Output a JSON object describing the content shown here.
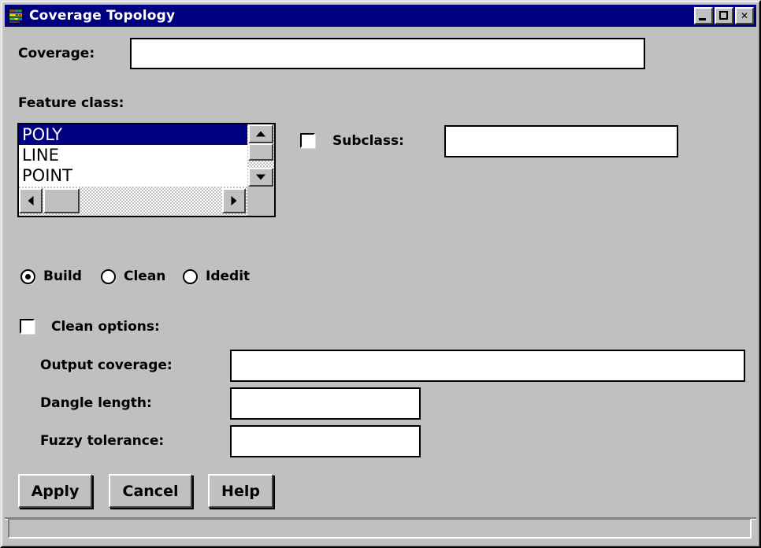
{
  "window": {
    "title": "Coverage Topology",
    "icon": "coverage-layers-icon",
    "titlebar_color": "#000080",
    "face_color": "#c0c0c0",
    "controls": {
      "minimize": "_",
      "maximize": "□",
      "close": "✕"
    }
  },
  "coverage": {
    "label": "Coverage:",
    "value": "",
    "placeholder": ""
  },
  "feature_class": {
    "label": "Feature class:",
    "items": [
      {
        "label": "POLY",
        "selected": true
      },
      {
        "label": "LINE",
        "selected": false
      },
      {
        "label": "POINT",
        "selected": false
      }
    ]
  },
  "subclass": {
    "label": "Subclass:",
    "checked": false,
    "value": "",
    "placeholder": ""
  },
  "operation": {
    "options": [
      {
        "label": "Build",
        "selected": true
      },
      {
        "label": "Clean",
        "selected": false
      },
      {
        "label": "Idedit",
        "selected": false
      }
    ]
  },
  "clean_options": {
    "label": "Clean options:",
    "checked": false,
    "fields": [
      {
        "label": "Output coverage:",
        "value": "",
        "placeholder": ""
      },
      {
        "label": "Dangle length:",
        "value": "",
        "placeholder": ""
      },
      {
        "label": "Fuzzy tolerance:",
        "value": "",
        "placeholder": ""
      }
    ]
  },
  "buttons": {
    "apply": "Apply",
    "cancel": "Cancel",
    "help": "Help"
  },
  "statusbar": {
    "text": ""
  }
}
